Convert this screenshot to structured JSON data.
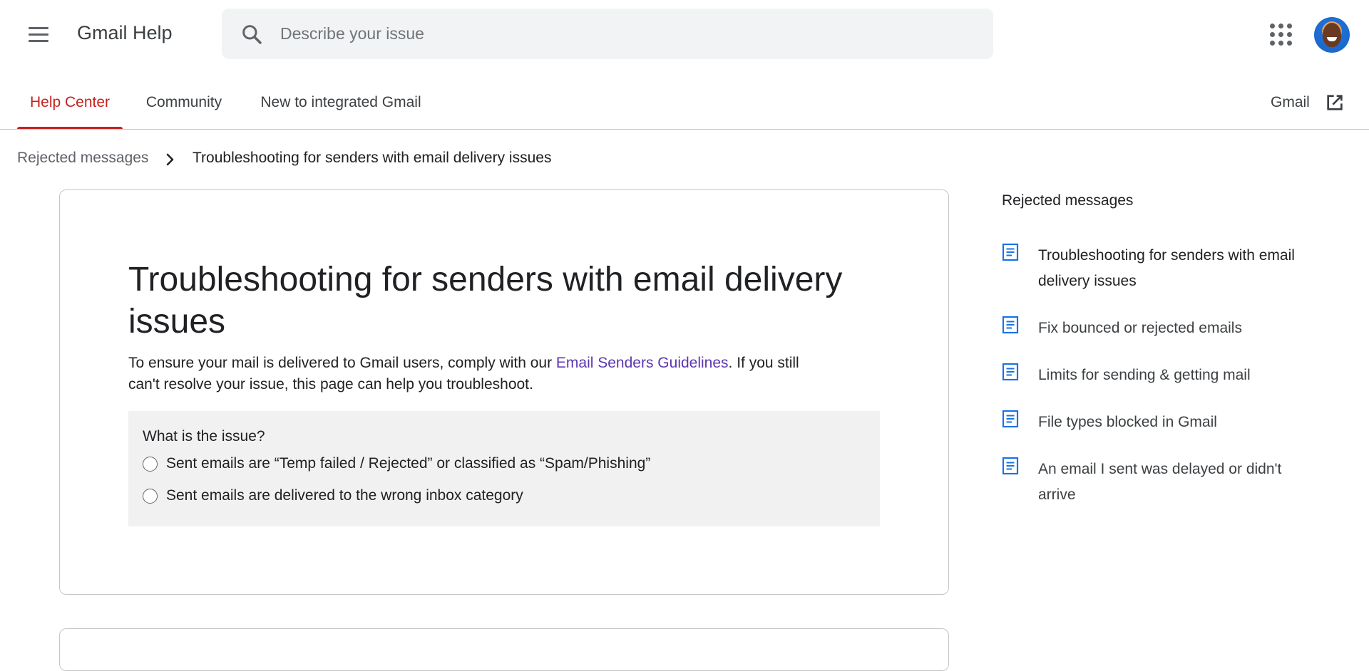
{
  "header": {
    "app_title": "Gmail Help",
    "search_placeholder": "Describe your issue"
  },
  "tabs": [
    {
      "label": "Help Center",
      "active": true
    },
    {
      "label": "Community",
      "active": false
    },
    {
      "label": "New to integrated Gmail",
      "active": false
    }
  ],
  "gmail_link": "Gmail",
  "breadcrumb": {
    "parent": "Rejected messages",
    "current": "Troubleshooting for senders with email delivery issues"
  },
  "article": {
    "title": "Troubleshooting for senders with email delivery issues",
    "intro_before": "To ensure your mail is delivered to Gmail users, comply with our ",
    "intro_link": "Email Senders Guidelines",
    "intro_after": ". If you still can't resolve your issue, this page can help you troubleshoot.",
    "question": "What is the issue?",
    "options": [
      "Sent emails are “Temp failed / Rejected” or classified as “Spam/Phishing”",
      "Sent emails are delivered to the wrong inbox category"
    ]
  },
  "sidebar": {
    "title": "Rejected messages",
    "items": [
      {
        "label": "Troubleshooting for senders with email delivery issues",
        "current": true
      },
      {
        "label": "Fix bounced or rejected emails",
        "current": false
      },
      {
        "label": "Limits for sending & getting mail",
        "current": false
      },
      {
        "label": "File types blocked in Gmail",
        "current": false
      },
      {
        "label": "An email I sent was delayed or didn't arrive",
        "current": false
      }
    ]
  },
  "colors": {
    "accent": "#c5221f",
    "link": "#5e35b1",
    "doc_icon": "#1a73e8",
    "issue_box_bg": "#f1f1f1"
  },
  "icons": [
    "menu-icon",
    "search-icon",
    "apps-icon",
    "avatar",
    "open-in-new-icon",
    "chevron-right-icon",
    "article-icon"
  ]
}
